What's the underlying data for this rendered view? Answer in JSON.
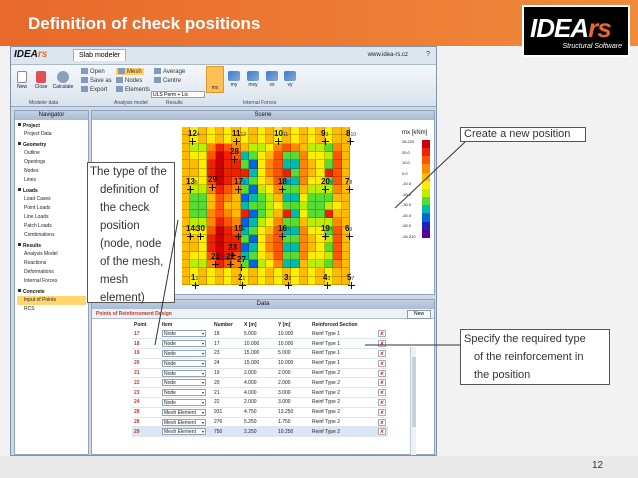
{
  "slide": {
    "title": "Definition of check positions",
    "page_number": "12",
    "logo": {
      "text_a": "IDEA",
      "text_b": "rs",
      "subtitle": "Structural Software"
    }
  },
  "app": {
    "logo_a": "IDEA",
    "logo_b": "rs",
    "ribbon_tab": "Slab modeler",
    "website": "www.idea-rs.cz",
    "help": "?",
    "ribbon": {
      "new": "New",
      "close": "Close",
      "calculate": "Calculate",
      "open": "Open",
      "save_as": "Save as",
      "export": "Export",
      "mesh": "Mesh",
      "nodes": "Nodes",
      "elements": "Elements",
      "average": "Average",
      "centre": "Centre",
      "load_case": "ULS Perm + Lic",
      "mx": "mx",
      "my": "my",
      "mxy": "mxy",
      "vx": "vx",
      "vy": "vy",
      "groups": [
        "Modeler data",
        "Analysis model",
        "Results",
        "Internal Forces"
      ]
    },
    "navigator": {
      "title": "Navigator",
      "sections": [
        {
          "title": "Project",
          "items": [
            "Project Data"
          ]
        },
        {
          "title": "Geometry",
          "items": [
            "Outline",
            "Openings",
            "Nodes",
            "Lines"
          ]
        },
        {
          "title": "Loads",
          "items": [
            "Load Cases",
            "Point Loads",
            "Line Loads",
            "Patch Loads",
            "Combinations"
          ]
        },
        {
          "title": "Results",
          "items": [
            "Analysis Model",
            "Reactions",
            "Deformations",
            "Internal Forces"
          ]
        },
        {
          "title": "Concrete",
          "items": [
            "Input of Points",
            "RCS"
          ]
        }
      ],
      "selected": "Input of Points"
    },
    "scene": {
      "title": "Scene",
      "legend_title": "mx [kNm]",
      "legend_labels": [
        "28.220",
        "20.0",
        "10.0",
        "0.0",
        "-10.0",
        "-20.0",
        "-30.0",
        "-40.0",
        "-50.0",
        "-54.210"
      ],
      "legend_colors": [
        "#cc0000",
        "#ee2200",
        "#ff5500",
        "#ff8800",
        "#ffbb00",
        "#ffee00",
        "#bbee00",
        "#55dd33",
        "#00bbaa",
        "#0066dd",
        "#2222bb",
        "#550099"
      ],
      "nodes": [
        {
          "n": "12",
          "s": "4"
        },
        {
          "n": "11",
          "s": "12"
        },
        {
          "n": "10",
          "s": "11"
        },
        {
          "n": "9",
          "s": "3"
        },
        {
          "n": "8",
          "s": "10"
        },
        {
          "n": "28",
          "s": ""
        },
        {
          "n": "13",
          "s": "5"
        },
        {
          "n": "29",
          "s": ""
        },
        {
          "n": "17",
          "s": "9"
        },
        {
          "n": "18",
          "s": "8"
        },
        {
          "n": "20",
          "s": "9"
        },
        {
          "n": "7",
          "s": "8"
        },
        {
          "n": "14",
          "s": "6"
        },
        {
          "n": "30",
          "s": ""
        },
        {
          "n": "15",
          "s": "6"
        },
        {
          "n": "16",
          "s": "7"
        },
        {
          "n": "19",
          "s": "7"
        },
        {
          "n": "6",
          "s": "9"
        },
        {
          "n": "23",
          "s": ""
        },
        {
          "n": "21",
          "s": "18"
        },
        {
          "n": "22",
          "s": ""
        },
        {
          "n": "27",
          "s": ""
        },
        {
          "n": "1",
          "s": "1"
        },
        {
          "n": "2",
          "s": "1"
        },
        {
          "n": "3",
          "s": "2"
        },
        {
          "n": "4",
          "s": "3"
        },
        {
          "n": "5",
          "s": "7"
        }
      ]
    },
    "data": {
      "title": "Data",
      "sub_title": "Points of Reinforcement Design",
      "new_button": "New",
      "columns": [
        "Point",
        "Item",
        "Number",
        "X [m]",
        "Y [m]",
        "Reinforced Section"
      ],
      "rows": [
        [
          "17",
          "Node",
          "18",
          "5.000",
          "10.000",
          "Reinf Type 1"
        ],
        [
          "18",
          "Node",
          "17",
          "10.000",
          "10.000",
          "Reinf Type 1"
        ],
        [
          "19",
          "Node",
          "23",
          "15.000",
          "5.000",
          "Reinf Type 1"
        ],
        [
          "20",
          "Node",
          "24",
          "15.000",
          "10.000",
          "Reinf Type 1"
        ],
        [
          "21",
          "Node",
          "19",
          "2.000",
          "2.000",
          "Reinf Type 2"
        ],
        [
          "22",
          "Node",
          "20",
          "4.000",
          "2.000",
          "Reinf Type 2"
        ],
        [
          "23",
          "Node",
          "21",
          "4.000",
          "3.000",
          "Reinf Type 2"
        ],
        [
          "24",
          "Node",
          "22",
          "2.000",
          "3.000",
          "Reinf Type 2"
        ],
        [
          "28",
          "Mesh Element",
          "931",
          "4.750",
          "13.250",
          "Reinf Type 2"
        ],
        [
          "28",
          "Mesh Element",
          "276",
          "5.250",
          "1.750",
          "Reinf Type 2"
        ],
        [
          "29",
          "Mesh Element",
          "750",
          "2.250",
          "10.250",
          "Reinf Type 2"
        ]
      ]
    }
  },
  "callouts": {
    "type_lines": [
      "The type of the",
      "definition of",
      "the check",
      "position",
      "(node, node",
      "of the mesh,",
      "mesh",
      "element)"
    ],
    "create": "Create a new position",
    "reinf_lines": [
      "Specify the required type",
      "of the reinforcement in",
      "the position"
    ]
  }
}
